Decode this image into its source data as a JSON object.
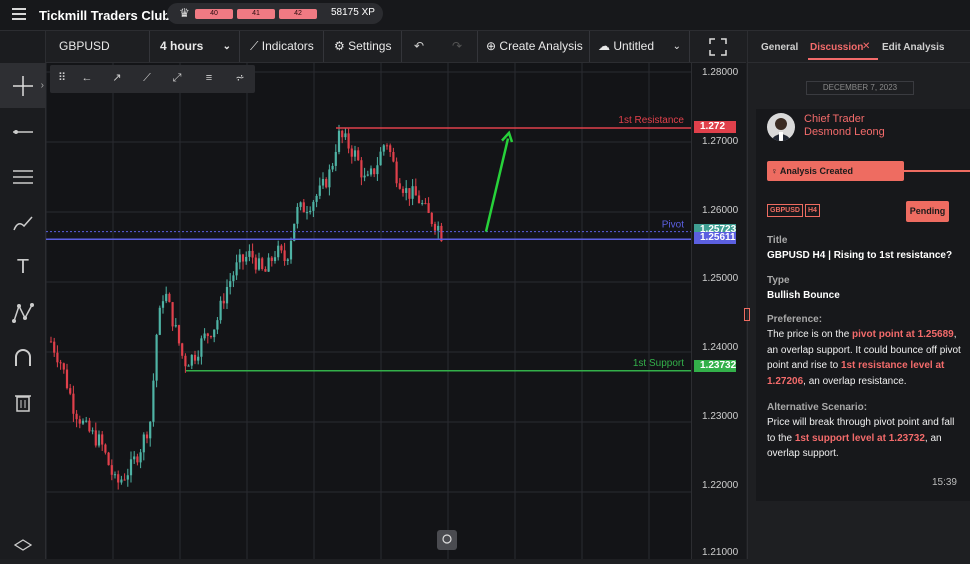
{
  "app": {
    "title": "Tickmill Traders Club"
  },
  "xp": {
    "levels": [
      "40",
      "41",
      "42"
    ],
    "label": "58175 XP"
  },
  "toolbar": {
    "symbol": "GBPUSD",
    "timeframe": "4 hours",
    "indicators_label": "Indicators",
    "settings_label": "Settings",
    "create_label": "Create Analysis",
    "save_label": "Untitled"
  },
  "chart": {
    "levels": [
      {
        "label": "1st Resistance",
        "value": 1.272,
        "tag": "1.272",
        "color": "#e0404b"
      },
      {
        "label": "Pivot",
        "value": 1.25611,
        "tag": "1.25611",
        "color": "#5b5fe0"
      },
      {
        "label": "1st Support",
        "value": 1.23732,
        "tag": "1.23732",
        "color": "#33b04a"
      }
    ],
    "last_price_tag": "1.25723",
    "y_ticks": [
      "1.28000",
      "1.27000",
      "1.26000",
      "1.25000",
      "1.24000",
      "1.23000",
      "1.22000",
      "1.21000"
    ],
    "y_range": [
      1.21,
      1.28
    ],
    "colors": {
      "up": "#4fb3a5",
      "down": "#e0404b",
      "arrow": "#27d23a"
    }
  },
  "panel": {
    "tabs": [
      "General",
      "Discussion",
      "Edit Analysis"
    ],
    "date": "DECEMBER 7, 2023",
    "author_role": "Chief Trader",
    "author_name": "Desmond Leong",
    "event_label": "Analysis Created",
    "tags": [
      "GBPUSD",
      "H4"
    ],
    "status": "Pending",
    "title_label": "Title",
    "title_value": "GBPUSD H4 | Rising to 1st resistance?",
    "type_label": "Type",
    "type_value": "Bullish Bounce",
    "pref_label": "Preference:",
    "pref_text_1": "The price is on the ",
    "pref_hl_1": "pivot point at 1.25689",
    "pref_text_2": ", an overlap support. It could bounce off pivot point and rise to ",
    "pref_hl_2": "1st resistance level at 1.27206",
    "pref_text_3": ", an overlap resistance.",
    "alt_label": "Alternative Scenario:",
    "alt_text_1": "Price will break through pivot point and fall to the ",
    "alt_hl_1": "1st support level at 1.23732",
    "alt_text_2": ",  an overlap support.",
    "time": "15:39"
  }
}
